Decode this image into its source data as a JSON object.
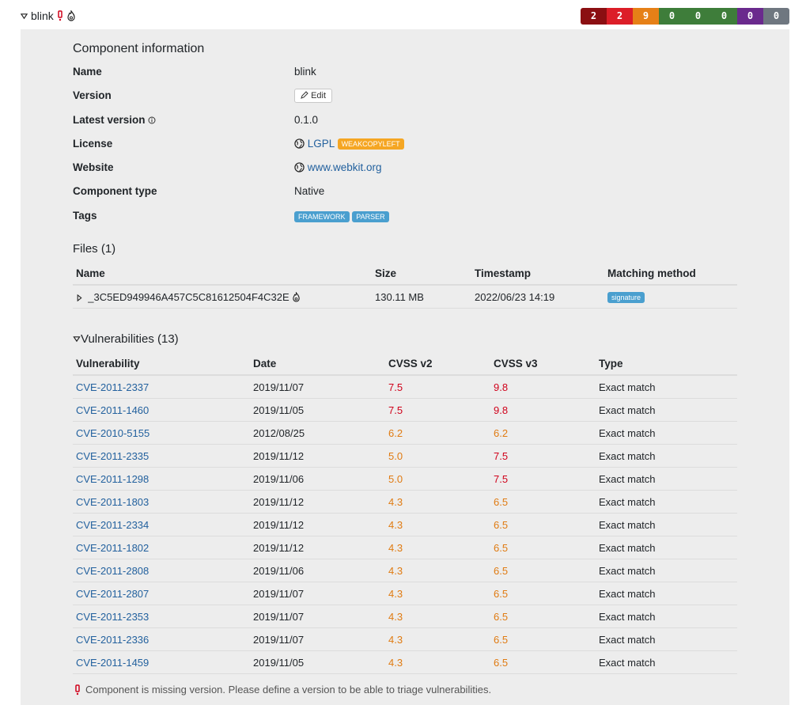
{
  "header": {
    "component_name": "blink",
    "severity_counts": [
      {
        "value": "2",
        "color": "#8b0f12"
      },
      {
        "value": "2",
        "color": "#dc1e28"
      },
      {
        "value": "9",
        "color": "#e68017"
      },
      {
        "value": "0",
        "color": "#3e7d3a"
      },
      {
        "value": "0",
        "color": "#3e7d3a"
      },
      {
        "value": "0",
        "color": "#3e7d3a"
      },
      {
        "value": "0",
        "color": "#6a2a8d"
      },
      {
        "value": "0",
        "color": "#6f7780"
      }
    ]
  },
  "info": {
    "title": "Component information",
    "name_label": "Name",
    "name_value": "blink",
    "version_label": "Version",
    "edit_button": "Edit",
    "latest_label": "Latest version",
    "latest_value": "0.1.0",
    "license_label": "License",
    "license_value": "LGPL",
    "license_badge": "WEAKCOPYLEFT",
    "website_label": "Website",
    "website_value": "www.webkit.org",
    "type_label": "Component type",
    "type_value": "Native",
    "tags_label": "Tags",
    "tags": [
      "FRAMEWORK",
      "PARSER"
    ]
  },
  "files": {
    "title": "Files (1)",
    "headers": [
      "Name",
      "Size",
      "Timestamp",
      "Matching method"
    ],
    "rows": [
      {
        "name": "_3C5ED949946A457C5C81612504F4C32E",
        "size": "130.11 MB",
        "timestamp": "2022/06/23 14:19",
        "method": "signature"
      }
    ]
  },
  "vulns": {
    "title": "Vulnerabilities (13)",
    "headers": [
      "Vulnerability",
      "Date",
      "CVSS v2",
      "CVSS v3",
      "Type"
    ],
    "rows": [
      {
        "id": "CVE-2011-2337",
        "date": "2019/11/07",
        "v2": "7.5",
        "v3": "9.8",
        "type": "Exact match"
      },
      {
        "id": "CVE-2011-1460",
        "date": "2019/11/05",
        "v2": "7.5",
        "v3": "9.8",
        "type": "Exact match"
      },
      {
        "id": "CVE-2010-5155",
        "date": "2012/08/25",
        "v2": "6.2",
        "v3": "6.2",
        "type": "Exact match"
      },
      {
        "id": "CVE-2011-2335",
        "date": "2019/11/12",
        "v2": "5.0",
        "v3": "7.5",
        "type": "Exact match"
      },
      {
        "id": "CVE-2011-1298",
        "date": "2019/11/06",
        "v2": "5.0",
        "v3": "7.5",
        "type": "Exact match"
      },
      {
        "id": "CVE-2011-1803",
        "date": "2019/11/12",
        "v2": "4.3",
        "v3": "6.5",
        "type": "Exact match"
      },
      {
        "id": "CVE-2011-2334",
        "date": "2019/11/12",
        "v2": "4.3",
        "v3": "6.5",
        "type": "Exact match"
      },
      {
        "id": "CVE-2011-1802",
        "date": "2019/11/12",
        "v2": "4.3",
        "v3": "6.5",
        "type": "Exact match"
      },
      {
        "id": "CVE-2011-2808",
        "date": "2019/11/06",
        "v2": "4.3",
        "v3": "6.5",
        "type": "Exact match"
      },
      {
        "id": "CVE-2011-2807",
        "date": "2019/11/07",
        "v2": "4.3",
        "v3": "6.5",
        "type": "Exact match"
      },
      {
        "id": "CVE-2011-2353",
        "date": "2019/11/07",
        "v2": "4.3",
        "v3": "6.5",
        "type": "Exact match"
      },
      {
        "id": "CVE-2011-2336",
        "date": "2019/11/07",
        "v2": "4.3",
        "v3": "6.5",
        "type": "Exact match"
      },
      {
        "id": "CVE-2011-1459",
        "date": "2019/11/05",
        "v2": "4.3",
        "v3": "6.5",
        "type": "Exact match"
      }
    ]
  },
  "footer_note": "Component is missing version. Please define a version to be able to triage vulnerabilities."
}
